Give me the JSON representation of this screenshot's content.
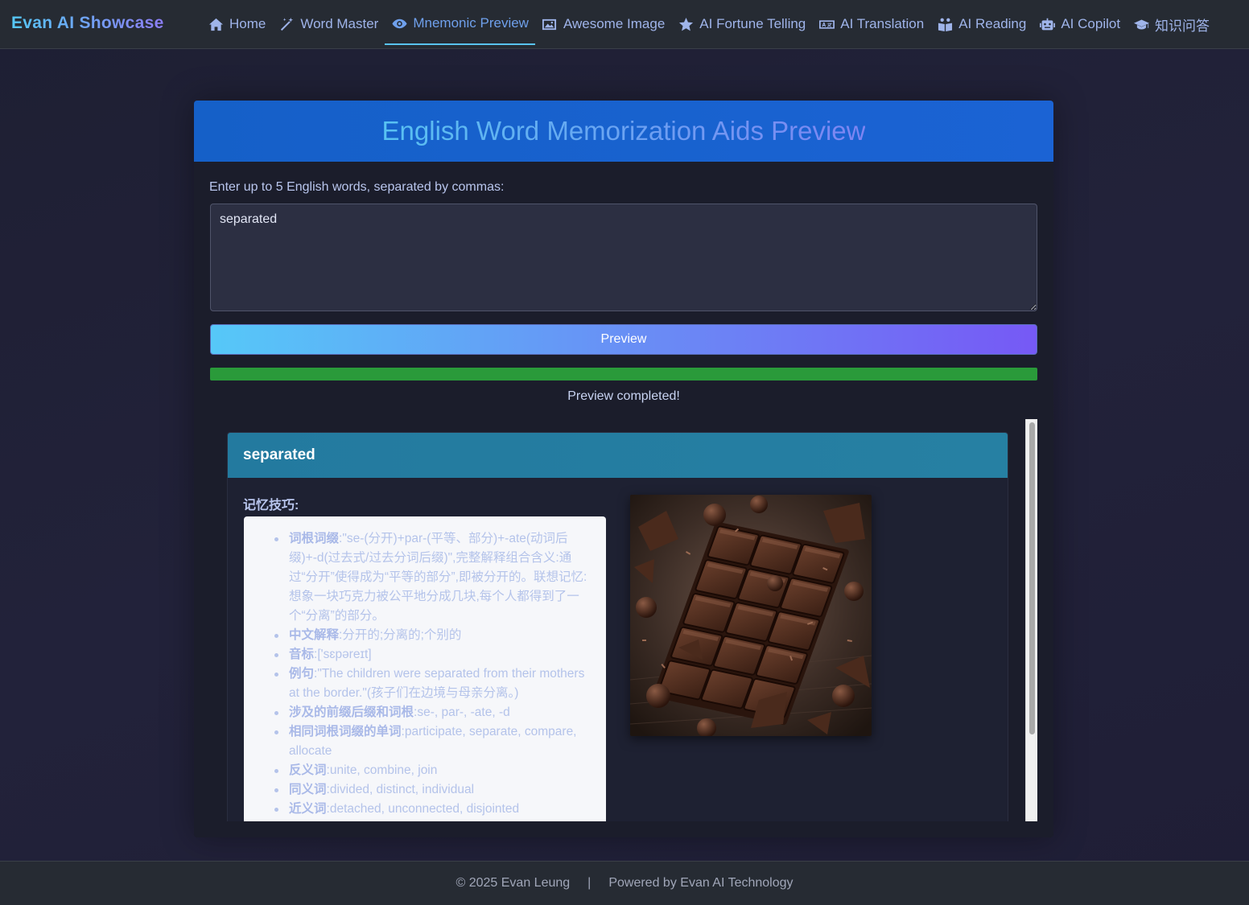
{
  "brand": "Evan AI Showcase",
  "nav": [
    {
      "label": "Home",
      "icon": "home-icon"
    },
    {
      "label": "Word Master",
      "icon": "magic-wand-icon"
    },
    {
      "label": "Mnemonic Preview",
      "icon": "eye-icon",
      "active": true
    },
    {
      "label": "Awesome Image",
      "icon": "image-icon"
    },
    {
      "label": "AI Fortune Telling",
      "icon": "star-icon"
    },
    {
      "label": "AI Translation",
      "icon": "translate-icon"
    },
    {
      "label": "AI Reading",
      "icon": "reader-icon"
    },
    {
      "label": "AI Copilot",
      "icon": "robot-icon"
    },
    {
      "label": "知识问答",
      "icon": "graduation-cap-icon"
    }
  ],
  "main": {
    "title": "English Word Memorization Aids Preview",
    "input_label": "Enter up to 5 English words, separated by commas:",
    "input_value": "separated",
    "preview_button": "Preview",
    "progress": 1.0,
    "status": "Preview completed!"
  },
  "result": {
    "word": "separated",
    "mnemonic_label": "记忆技巧:",
    "items": [
      {
        "key": "词根词缀",
        "text": ":\"se-(分开)+par-(平等、部分)+-ate(动词后缀)+-d(过去式/过去分词后缀)\",完整解释组合含义:通过“分开”使得成为“平等的部分”,即被分开的。联想记忆:想象一块巧克力被公平地分成几块,每个人都得到了一个“分离”的部分。"
      },
      {
        "key": "中文解释",
        "text": ":分开的;分离的;个别的"
      },
      {
        "key": "音标",
        "text": ":['sɛpəreɪt]"
      },
      {
        "key": "例句",
        "text": ":\"The children were separated from their mothers at the border.\"(孩子们在边境与母亲分离。)"
      },
      {
        "key": "涉及的前缀后缀和词根",
        "text": ":se-, par-, -ate, -d"
      },
      {
        "key": "相同词根词缀的单词",
        "text": ":participate, separate, compare, allocate"
      },
      {
        "key": "反义词",
        "text": ":unite, combine, join"
      },
      {
        "key": "同义词",
        "text": ":divided, distinct, individual"
      },
      {
        "key": "近义词",
        "text": ":detached, unconnected, disjointed"
      }
    ],
    "image_subject": "chocolate-bar-image"
  },
  "footer": {
    "copyright": "© 2025 Evan Leung",
    "separator": "|",
    "powered": "Powered by Evan AI Technology"
  }
}
